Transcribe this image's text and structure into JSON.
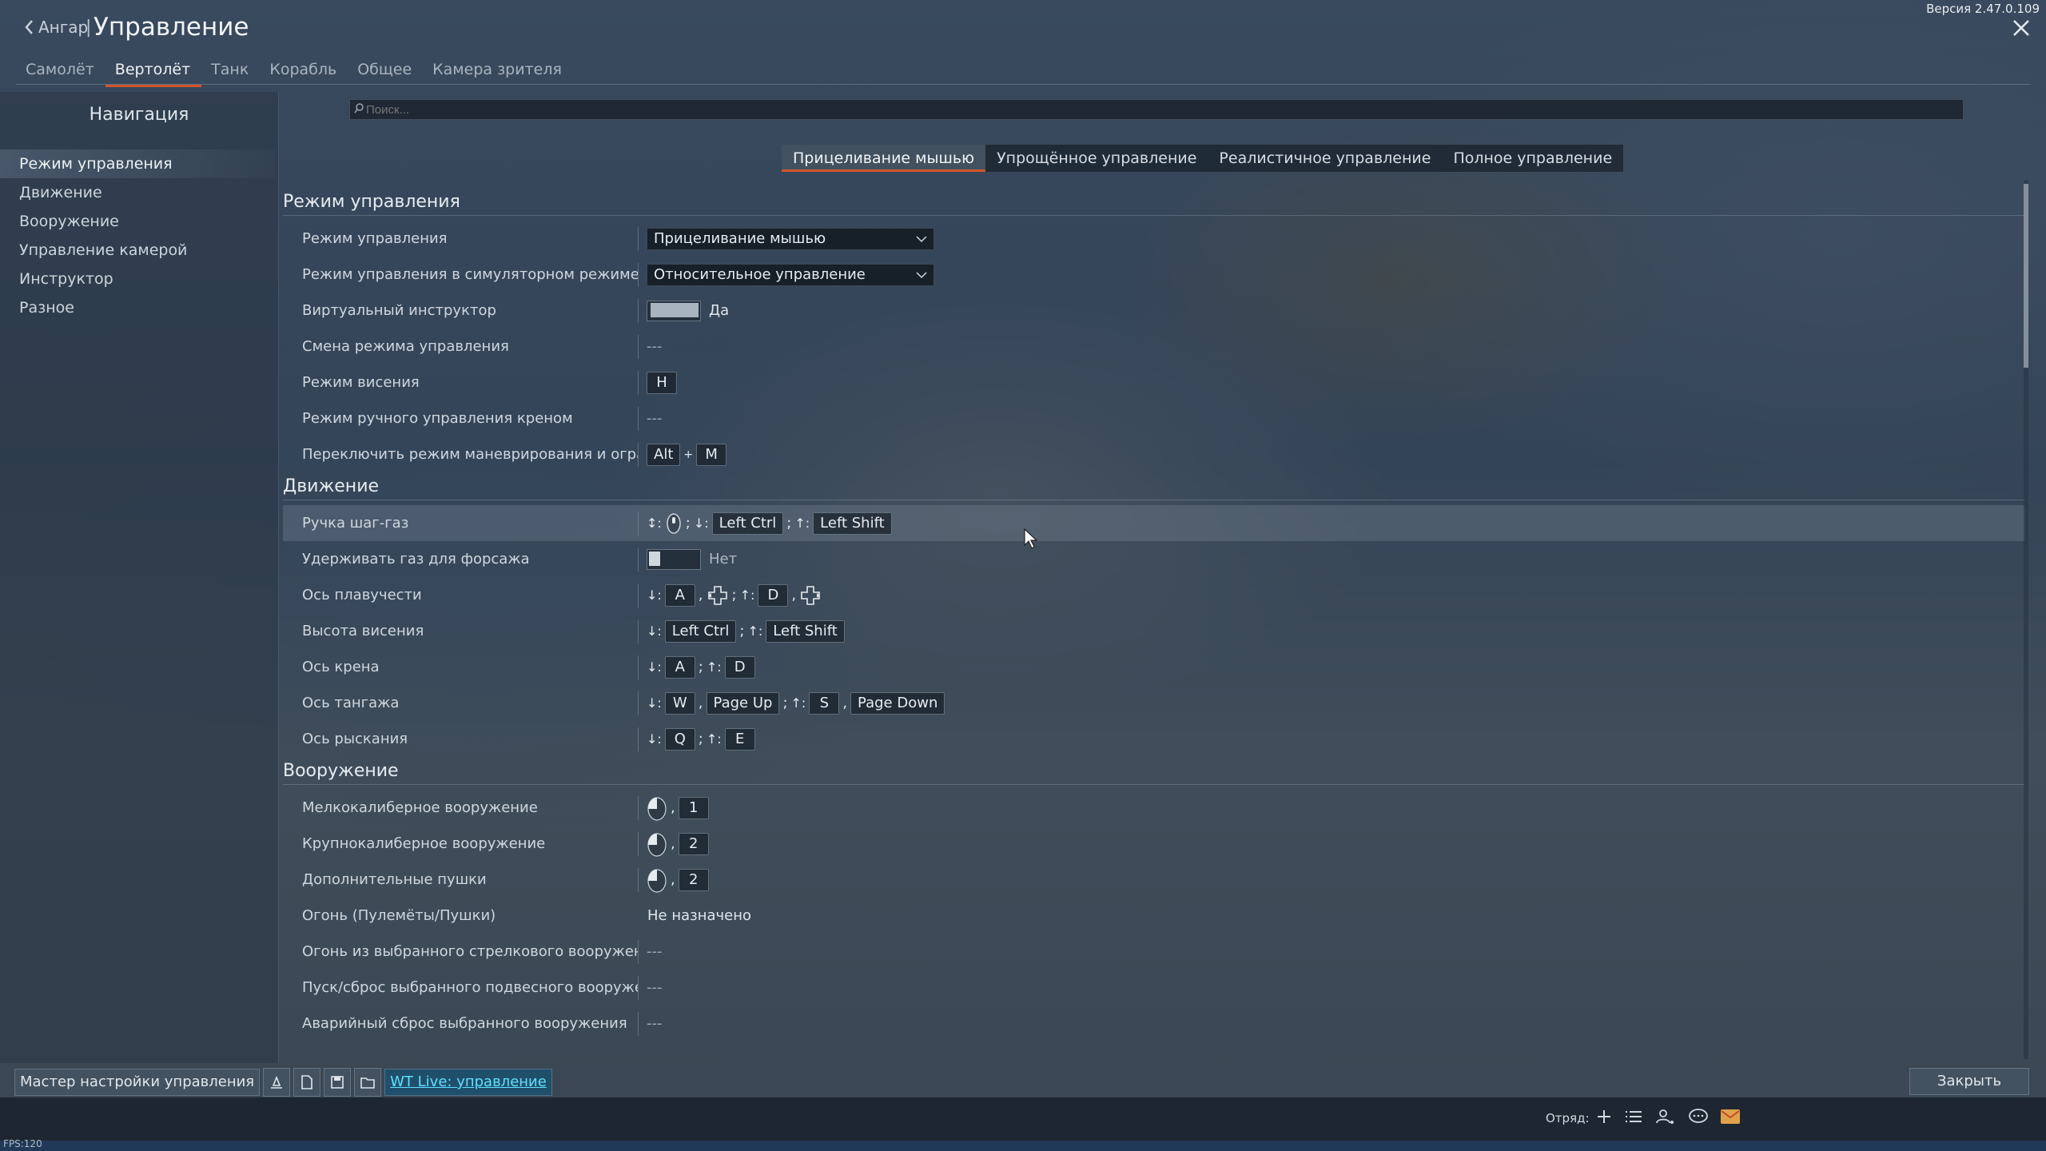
{
  "header": {
    "back_label": "Ангар",
    "separator": "|",
    "title": "Управление",
    "version": "Версия 2.47.0.109"
  },
  "tabs": [
    {
      "label": "Самолёт"
    },
    {
      "label": "Вертолёт"
    },
    {
      "label": "Танк"
    },
    {
      "label": "Корабль"
    },
    {
      "label": "Общее"
    },
    {
      "label": "Камера зрителя"
    }
  ],
  "nav": {
    "title": "Навигация",
    "items": [
      {
        "label": "Режим управления"
      },
      {
        "label": "Движение"
      },
      {
        "label": "Вооружение"
      },
      {
        "label": "Управление камерой"
      },
      {
        "label": "Инструктор"
      },
      {
        "label": "Разное"
      }
    ]
  },
  "search": {
    "placeholder": "Поиск..."
  },
  "modes": [
    {
      "label": "Прицеливание мышью"
    },
    {
      "label": "Упрощённое управление"
    },
    {
      "label": "Реалистичное управление"
    },
    {
      "label": "Полное управление"
    }
  ],
  "sections": {
    "control_mode": {
      "title": "Режим управления",
      "rows": [
        {
          "label": "Режим управления",
          "value": "Прицеливание мышью"
        },
        {
          "label": "Режим управления в симуляторном режиме",
          "value": "Относительное управление"
        },
        {
          "label": "Виртуальный инструктор",
          "value": "Да"
        },
        {
          "label": "Смена режима управления",
          "value": "---"
        },
        {
          "label": "Режим висения",
          "key": "H"
        },
        {
          "label": "Режим ручного управления креном",
          "value": "---"
        },
        {
          "label": "Переключить режим маневрирования и огра",
          "keys": [
            "Alt",
            "M"
          ],
          "plus": "+"
        }
      ]
    },
    "movement": {
      "title": "Движение",
      "rows": [
        {
          "label": "Ручка шаг-газ",
          "keys": [
            "Left Ctrl",
            "Left Shift"
          ]
        },
        {
          "label": "Удерживать газ для форсажа",
          "value": "Нет"
        },
        {
          "label": "Ось плавучести",
          "keys": [
            "A",
            "D"
          ]
        },
        {
          "label": "Высота висения",
          "keys": [
            "Left Ctrl",
            "Left Shift"
          ]
        },
        {
          "label": "Ось крена",
          "keys": [
            "A",
            "D"
          ]
        },
        {
          "label": "Ось тангажа",
          "keys": [
            "W",
            "Page Up",
            "S",
            "Page Down"
          ]
        },
        {
          "label": "Ось рыскания",
          "keys": [
            "Q",
            "E"
          ]
        }
      ]
    },
    "weapons": {
      "title": "Вооружение",
      "rows": [
        {
          "label": "Мелкокалиберное вооружение",
          "key": "1"
        },
        {
          "label": "Крупнокалиберное вооружение",
          "key": "2"
        },
        {
          "label": "Дополнительные пушки",
          "key": "2"
        },
        {
          "label": "Огонь (Пулемёты/Пушки)",
          "value": "Не назначено"
        },
        {
          "label": "Огонь из выбранного стрелкового вооружені",
          "value": "---"
        },
        {
          "label": "Пуск/сброс выбранного подвесного вооруже",
          "value": "---"
        },
        {
          "label": "Аварийный сброс выбранного вооружения",
          "value": "---"
        }
      ]
    }
  },
  "footer": {
    "wizard": "Мастер настройки управления",
    "live": "WT Live: управление",
    "close": "Закрыть",
    "squad": "Отряд:",
    "fps": "FPS:120"
  },
  "colors": {
    "accent": "#d3542a",
    "live_text": "#5ee0ff"
  }
}
